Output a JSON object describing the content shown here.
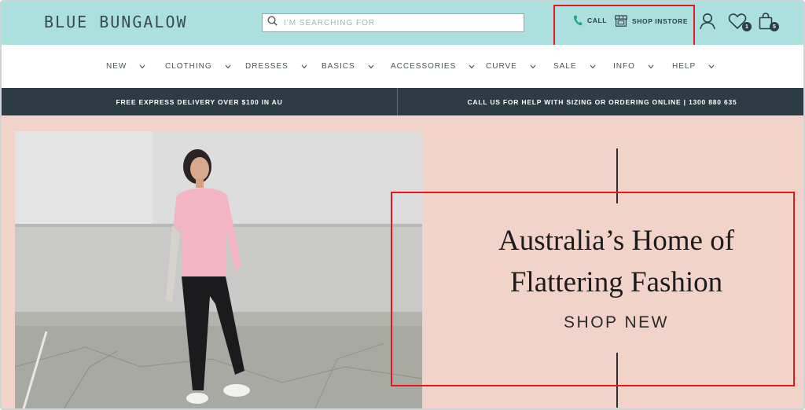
{
  "header": {
    "logo": "BLUE BUNGALOW",
    "search": {
      "placeholder": "I'M SEARCHING FOR",
      "value": ""
    },
    "links": {
      "call": "CALL",
      "shop_instore": "SHOP INSTORE"
    },
    "wishlist_count": "1",
    "cart_count": "5"
  },
  "nav": {
    "items": [
      {
        "label": "NEW"
      },
      {
        "label": "CLOTHING"
      },
      {
        "label": "DRESSES"
      },
      {
        "label": "BASICS"
      },
      {
        "label": "ACCESSORIES"
      },
      {
        "label": "CURVE"
      },
      {
        "label": "SALE"
      },
      {
        "label": "INFO"
      },
      {
        "label": "HELP"
      }
    ]
  },
  "announcement": {
    "left": "FREE EXPRESS DELIVERY OVER $100 IN AU",
    "right": "CALL US FOR HELP WITH SIZING OR ORDERING ONLINE | 1300 880 635"
  },
  "hero": {
    "title_line1": "Australia’s Home of",
    "title_line2": "Flattering Fashion",
    "cta": "SHOP NEW"
  },
  "colors": {
    "header_bg": "#ace0de",
    "announce_bg": "#2d3b45",
    "hero_bg": "#f2d3c9",
    "highlight": "#e8161b",
    "call_icon": "#1aa58a"
  }
}
